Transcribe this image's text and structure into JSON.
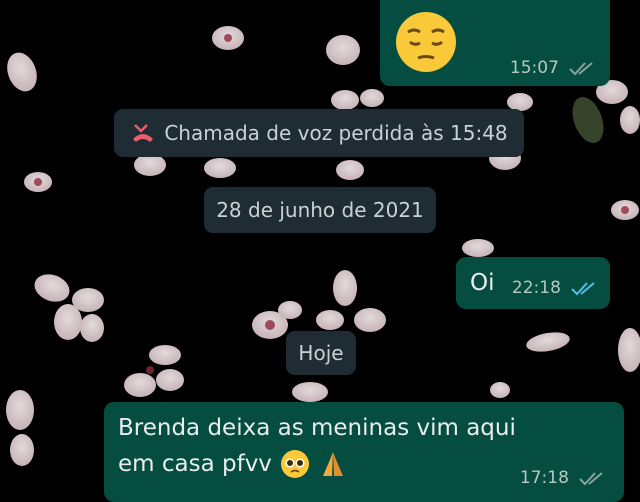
{
  "colors": {
    "outgoing_bubble": "#054d40",
    "system_bubble": "#1f2c33",
    "read_ticks": "#53bdeb",
    "delivered_ticks": "#8aa39f",
    "missed_call_icon": "#f15c6d"
  },
  "messages": [
    {
      "type": "outgoing",
      "emoji": "pensive-face",
      "time": "15:07",
      "status": "delivered"
    },
    {
      "type": "system",
      "icon": "missed-voice-call-icon",
      "text": "Chamada de voz perdida às 15:48"
    },
    {
      "type": "date",
      "text": "28 de junho de 2021"
    },
    {
      "type": "outgoing",
      "text": "Oi",
      "time": "22:18",
      "status": "read"
    },
    {
      "type": "date",
      "text": "Hoje"
    },
    {
      "type": "outgoing",
      "line1": "Brenda deixa as meninas vim aqui",
      "line2": "em casa pfvv",
      "emojis": [
        "pleading-face",
        "folded-hands"
      ],
      "time": "17:18",
      "status": "delivered"
    }
  ]
}
